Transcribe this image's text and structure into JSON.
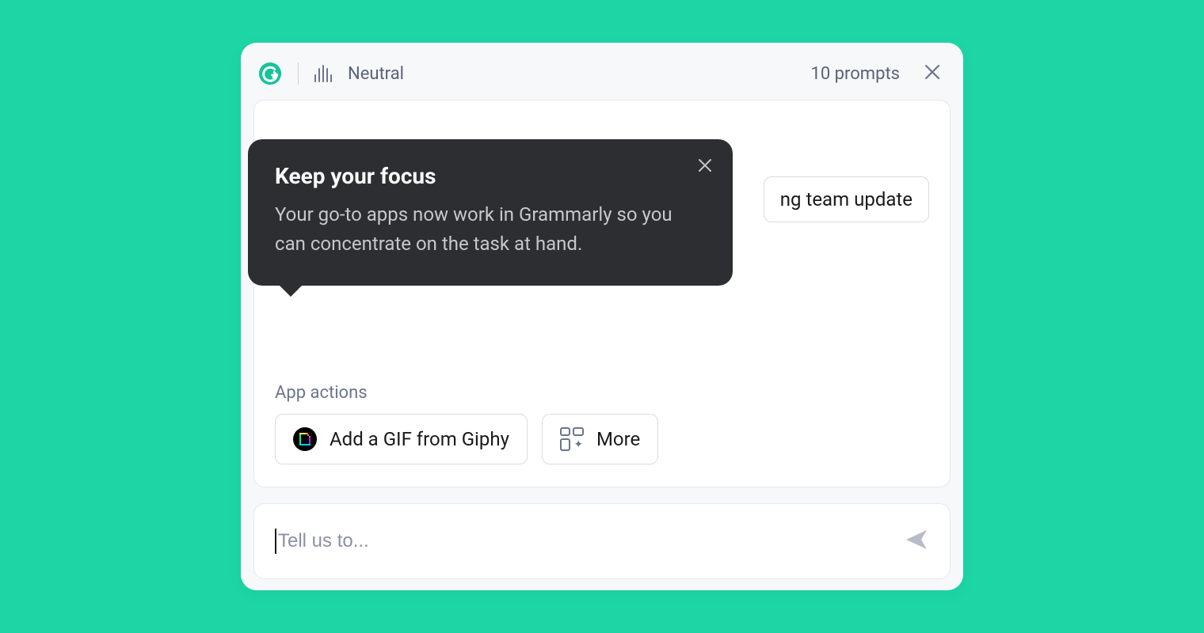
{
  "header": {
    "tone_label": "Neutral",
    "prompts_label": "10 prompts"
  },
  "tooltip": {
    "title": "Keep your focus",
    "body": "Your go-to apps now work in Grammarly so you can concentrate on the task at hand."
  },
  "suggestion_chip_visible_text": "ng team update",
  "app_actions": {
    "label": "App actions",
    "giphy_label": "Add a GIF from Giphy",
    "more_label": "More"
  },
  "input": {
    "placeholder": "Tell us to..."
  }
}
